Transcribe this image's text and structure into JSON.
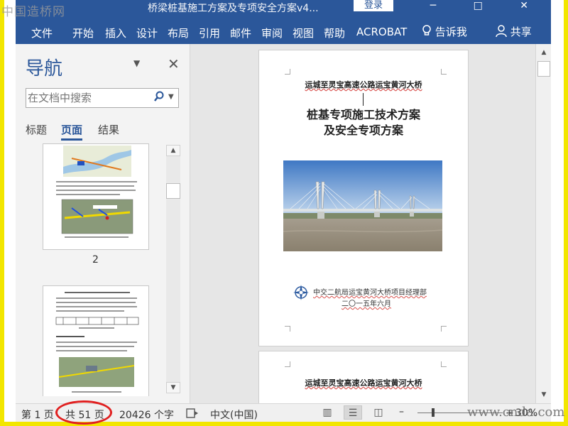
{
  "watermark_top": "中国造桥网",
  "titlebar": {
    "doc_title": "桥梁桩基施工方案及专项安全方案v4...",
    "login_label": "登录",
    "window_buttons": [
      "─",
      "□",
      "✕"
    ]
  },
  "ribbon": {
    "tabs": [
      "文件",
      "开始",
      "插入",
      "设计",
      "布局",
      "引用",
      "邮件",
      "审阅",
      "视图",
      "帮助",
      "ACROBAT"
    ],
    "tell_me": "告诉我",
    "share": "共享",
    "icons": {
      "tell_me": "lightbulb-icon",
      "share": "person-icon"
    }
  },
  "nav": {
    "title": "导航",
    "search_placeholder": "在文档中搜索",
    "tabs": [
      "标题",
      "页面",
      "结果"
    ],
    "active_tab": "页面",
    "page_numbers": [
      "2"
    ]
  },
  "document": {
    "page1": {
      "header": "运城至灵宝高速公路运宝黄河大桥",
      "title_line1": "桩基专项施工技术方案",
      "title_line2": "及安全专项方案",
      "org": "中交二航局运宝黄河大桥项目经理部",
      "date": "二〇一五年六月"
    },
    "page2": {
      "header": "运城至灵宝高速公路运宝黄河大桥"
    }
  },
  "status": {
    "page": "第 1 页",
    "total": "共 51 页",
    "words": "20426 个字",
    "language": "中文(中国)",
    "zoom": "30%",
    "zoom_minus": "–",
    "zoom_plus": "+"
  },
  "watermark_bottom": "www.cnda.com"
}
